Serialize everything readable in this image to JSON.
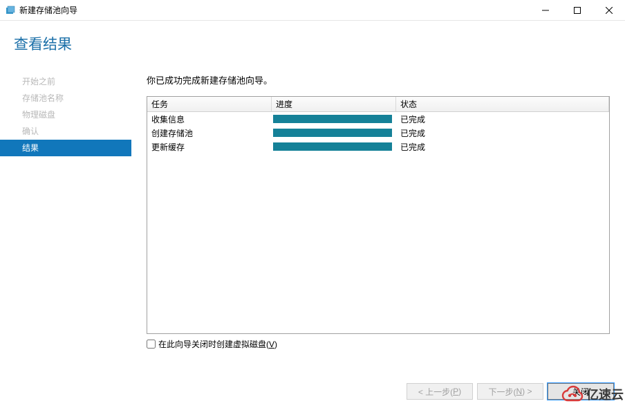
{
  "window": {
    "title": "新建存储池向导"
  },
  "header": {
    "title": "查看结果"
  },
  "sidebar": {
    "items": [
      {
        "label": "开始之前",
        "active": false
      },
      {
        "label": "存储池名称",
        "active": false
      },
      {
        "label": "物理磁盘",
        "active": false
      },
      {
        "label": "确认",
        "active": false
      },
      {
        "label": "结果",
        "active": true
      }
    ]
  },
  "main": {
    "message": "你已成功完成新建存储池向导。",
    "columns": {
      "task": "任务",
      "progress": "进度",
      "status": "状态"
    },
    "rows": [
      {
        "task": "收集信息",
        "progress": 100,
        "status": "已完成"
      },
      {
        "task": "创建存储池",
        "progress": 100,
        "status": "已完成"
      },
      {
        "task": "更新缓存",
        "progress": 100,
        "status": "已完成"
      }
    ],
    "checkbox": {
      "label_prefix": "在此向导关闭时创建虚拟磁盘(",
      "hotkey": "V",
      "label_suffix": ")",
      "checked": false
    }
  },
  "footer": {
    "prev_pre": "< 上一步(",
    "prev_key": "P",
    "prev_post": ")",
    "next_pre": "下一步(",
    "next_key": "N",
    "next_post": ") >",
    "close": "关闭"
  },
  "watermark": {
    "text": "亿速云"
  }
}
